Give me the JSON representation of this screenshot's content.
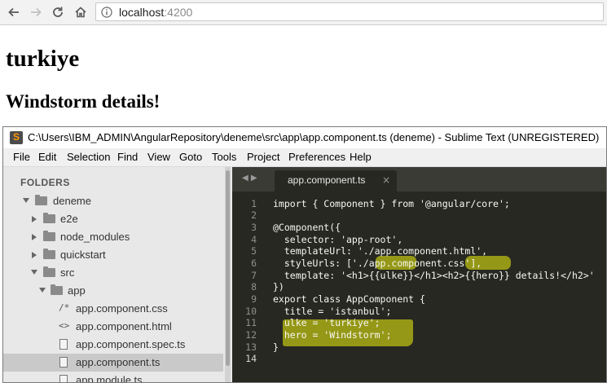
{
  "browser": {
    "url_host": "localhost",
    "url_port": ":4200",
    "icons": [
      "back-arrow-icon",
      "forward-arrow-icon",
      "reload-icon",
      "home-icon",
      "info-icon"
    ]
  },
  "page": {
    "heading1": "turkiye",
    "heading2": "Windstorm details!"
  },
  "sublime": {
    "title": "C:\\Users\\IBM_ADMIN\\AngularRepository\\deneme\\src\\app\\app.component.ts (deneme) - Sublime Text (UNREGISTERED)",
    "menu": [
      "File",
      "Edit",
      "Selection",
      "Find",
      "View",
      "Goto",
      "Tools",
      "Project",
      "Preferences",
      "Help"
    ],
    "sidebar": {
      "header": "FOLDERS",
      "items": [
        {
          "label": "deneme",
          "type": "folder-open"
        },
        {
          "label": "e2e",
          "type": "folder"
        },
        {
          "label": "node_modules",
          "type": "folder"
        },
        {
          "label": "quickstart",
          "type": "folder"
        },
        {
          "label": "src",
          "type": "folder-open"
        },
        {
          "label": "app",
          "type": "folder-open"
        },
        {
          "label": "app.component.css",
          "type": "css",
          "glyph": "/*"
        },
        {
          "label": "app.component.html",
          "type": "html",
          "glyph": "<>"
        },
        {
          "label": "app.component.spec.ts",
          "type": "file"
        },
        {
          "label": "app.component.ts",
          "type": "file",
          "selected": true
        },
        {
          "label": "app.module.ts",
          "type": "file"
        }
      ]
    },
    "tab": {
      "nav": "◀ ▶",
      "label": "app.component.ts",
      "close": "×"
    },
    "code": {
      "line_numbers": [
        "1",
        "2",
        "3",
        "4",
        "5",
        "6",
        "7",
        "8",
        "9",
        "10",
        "11",
        "12",
        "13",
        "14"
      ],
      "lines": [
        "import { Component } from '@angular/core';",
        "",
        "@Component({",
        "  selector: 'app-root',",
        "  templateUrl: './app.component.html',",
        "  styleUrls: ['./app.component.css'],",
        "  template: '<h1>{{ulke}}</h1><h2>{{hero}} details!</h2>'",
        "})",
        "export class AppComponent {",
        "  title = 'istanbul';",
        "  ulke = 'turkiye';",
        "  hero = 'Windstorm';",
        "}",
        ""
      ]
    },
    "colors": {
      "editor_bg": "#272822",
      "highlight": "#c1c414"
    }
  }
}
